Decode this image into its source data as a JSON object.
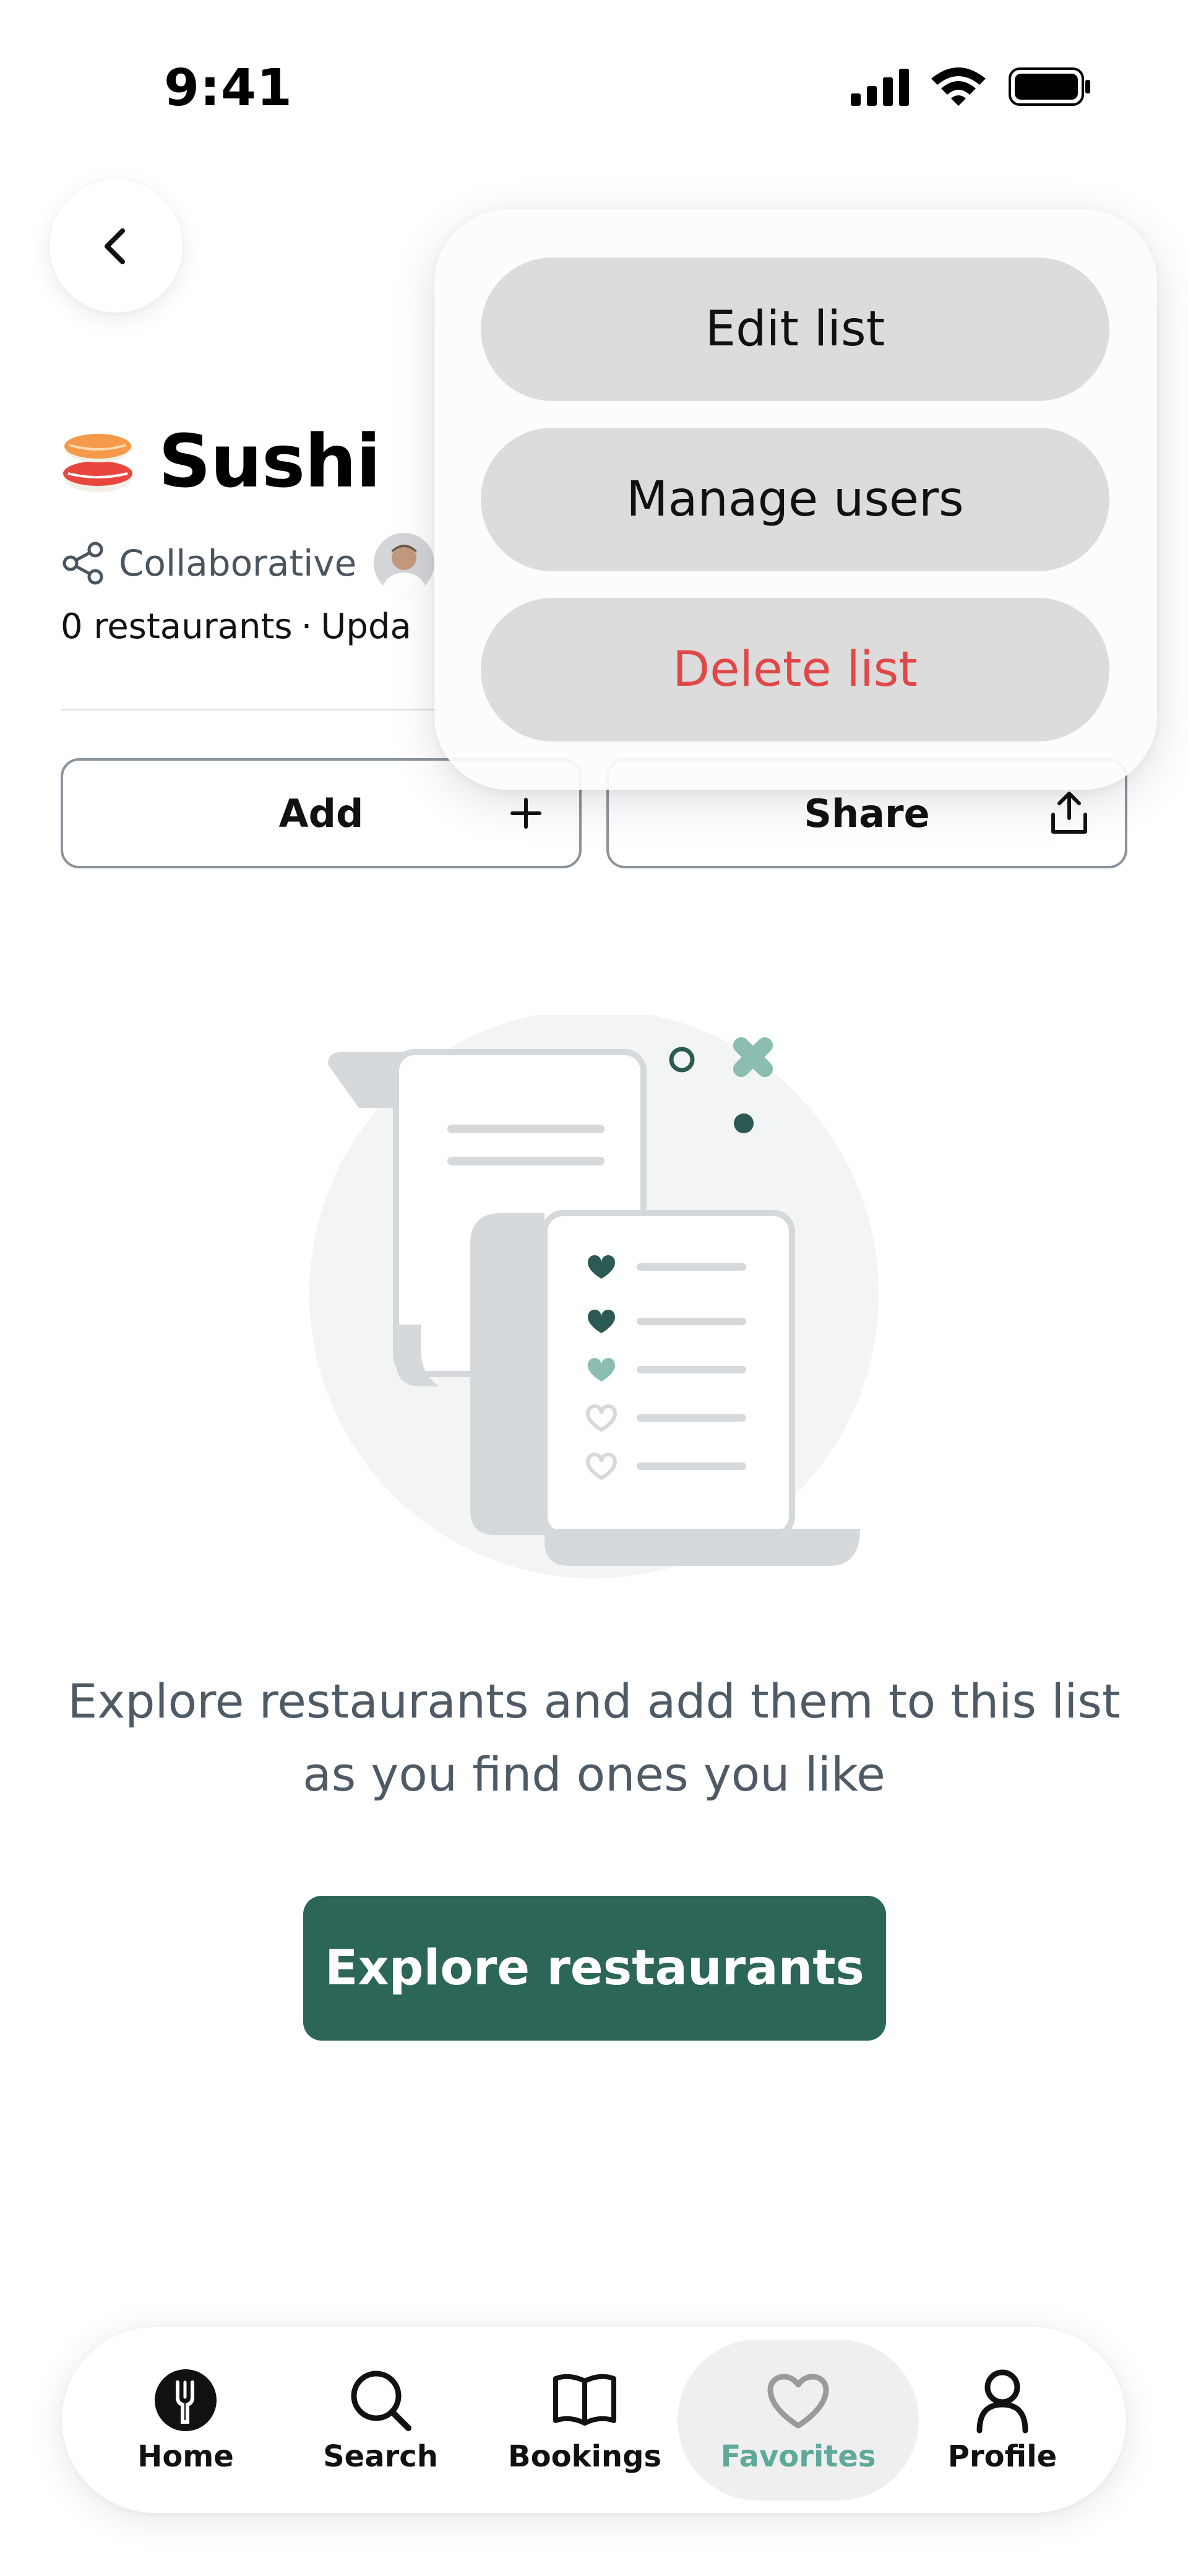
{
  "status_bar": {
    "time": "9:41",
    "icons": [
      "signal-icon",
      "wifi-icon",
      "battery-icon"
    ]
  },
  "header": {
    "back_icon": "chevron-left-icon",
    "emoji_icon": "sushi-icon",
    "title": "Sushi",
    "share_meta_icon": "share-nodes-icon",
    "collaborative_label": "Collaborative",
    "restaurant_count": "0 restaurants",
    "separator": "·",
    "updated_text": "Upda"
  },
  "actions": {
    "add_label": "Add",
    "add_icon": "plus-icon",
    "share_label": "Share",
    "share_icon": "share-upload-icon"
  },
  "empty_state": {
    "illustration_icon": "receipt-hearts-illustration",
    "message": "Explore restaurants and add them to this list as you find ones you like",
    "button_label": "Explore restaurants"
  },
  "menu": {
    "edit_label": "Edit list",
    "manage_label": "Manage users",
    "delete_label": "Delete list"
  },
  "nav": {
    "items": [
      {
        "label": "Home",
        "icon": "home-fork-icon",
        "active": false
      },
      {
        "label": "Search",
        "icon": "search-icon",
        "active": false
      },
      {
        "label": "Bookings",
        "icon": "book-icon",
        "active": false
      },
      {
        "label": "Favorites",
        "icon": "heart-icon",
        "active": true
      },
      {
        "label": "Profile",
        "icon": "person-icon",
        "active": false
      }
    ]
  },
  "colors": {
    "primary": "#2c6659",
    "accent_light": "#5ea99a",
    "destructive": "#e04848",
    "text_muted": "#4e5a66"
  }
}
